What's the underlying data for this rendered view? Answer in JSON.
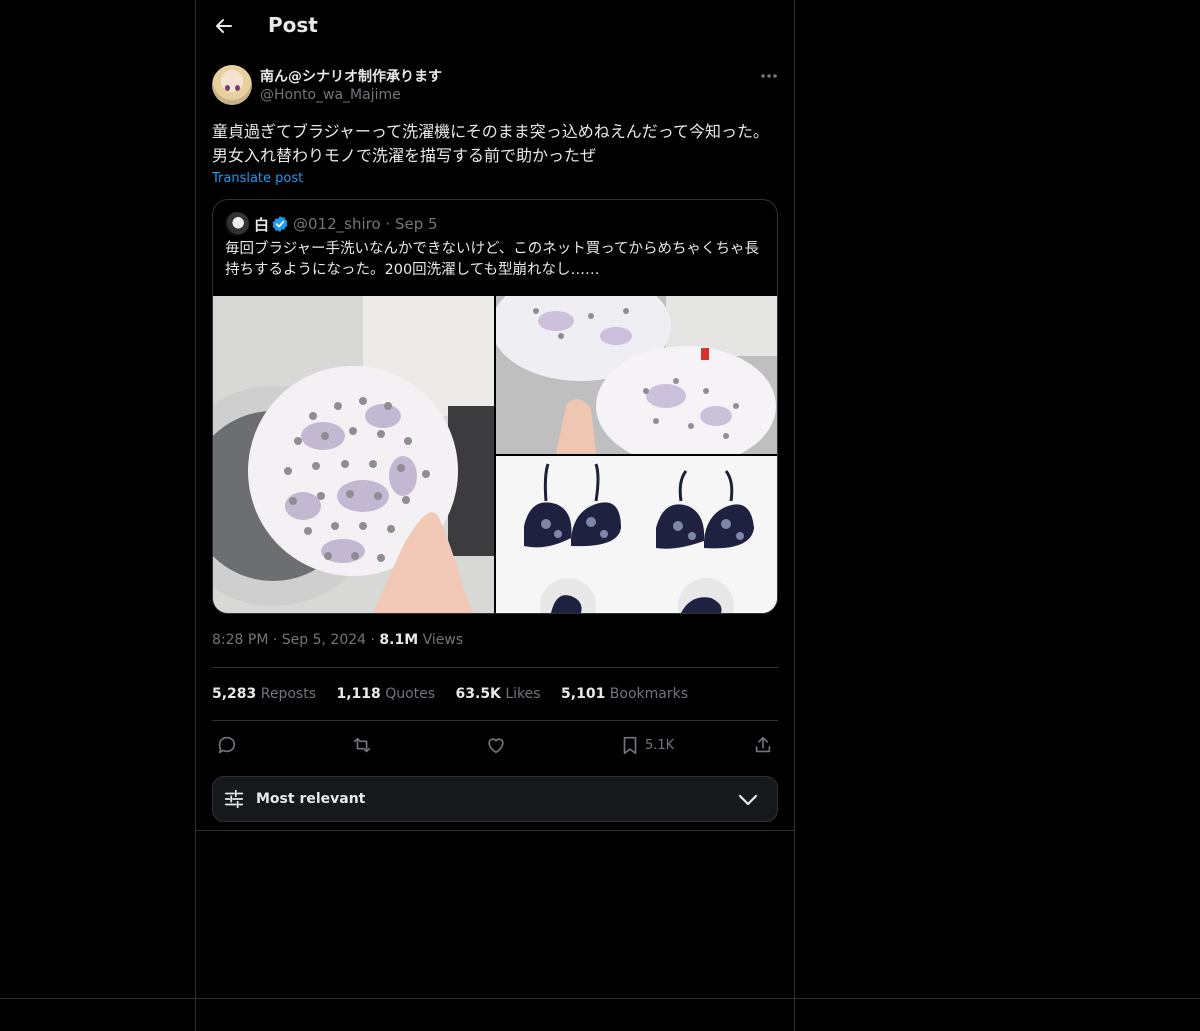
{
  "header": {
    "title": "Post"
  },
  "post": {
    "author_name": "南ん@シナリオ制作承ります",
    "author_handle": "@Honto_wa_Majime",
    "text": "童貞過ぎてブラジャーって洗濯機にそのまま突っ込めねえんだって今知った。男女入れ替わりモノで洗濯を描写する前で助かったぜ",
    "translate_label": "Translate post",
    "time": "8:28 PM",
    "date": "Sep 5, 2024",
    "views_count": "8.1M",
    "views_label": "Views"
  },
  "quote": {
    "author_name": "白",
    "verified": true,
    "author_handle": "@012_shiro",
    "date": "Sep 5",
    "text": "毎回ブラジャー手洗いなんかできないけど、このネット買ってからめちゃくちゃ長持ちするようになった。200回洗濯しても型崩れなし……"
  },
  "stats": [
    {
      "count": "5,283",
      "label": "Reposts"
    },
    {
      "count": "1,118",
      "label": "Quotes"
    },
    {
      "count": "63.5K",
      "label": "Likes"
    },
    {
      "count": "5,101",
      "label": "Bookmarks"
    }
  ],
  "actions": {
    "bookmark_count": "5.1K"
  },
  "sort": {
    "label": "Most relevant"
  },
  "colors": {
    "background": "#000000",
    "text": "#e7e9ea",
    "muted": "#71767b",
    "accent": "#1d9bf0",
    "border": "#2f3336"
  }
}
